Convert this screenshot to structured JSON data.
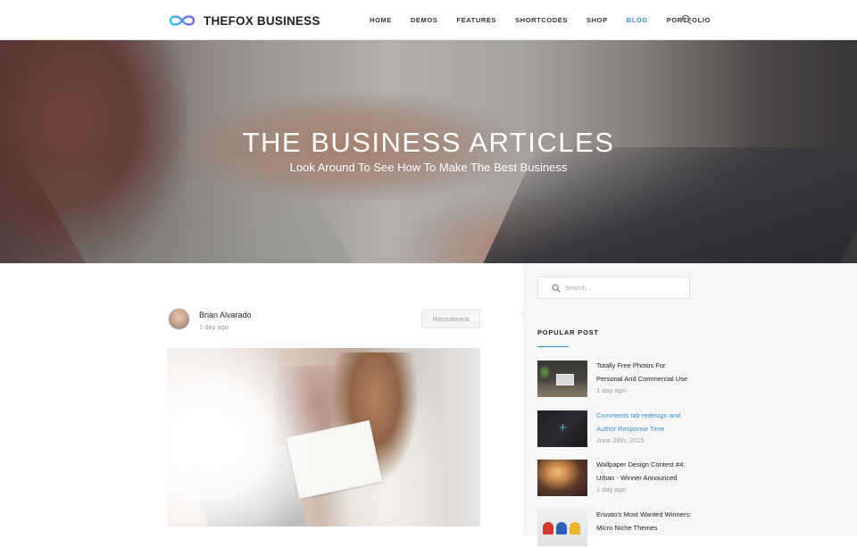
{
  "header": {
    "brand": "THEFOX BUSINESS",
    "nav": [
      "HOME",
      "DEMOS",
      "FEATURES",
      "SHORTCODES",
      "SHOP",
      "BLOG",
      "PORTFOLIO"
    ],
    "active_nav": "BLOG",
    "search_icon": "search-icon"
  },
  "hero": {
    "title": "THE BUSINESS ARTICLES",
    "subtitle": "Look Around To See How To Make The Best Business"
  },
  "post": {
    "author": "Brian Alvarado",
    "date": "1 day ago",
    "category": "Recruitment"
  },
  "sidebar": {
    "search_placeholder": "Search...",
    "popular_heading": "POPULAR POST",
    "popular_posts": [
      {
        "title": "Totally Free Photos For Personal And Commercial Use",
        "date": "1 day ago"
      },
      {
        "title": "Comments tab redesign and Author Response Time",
        "date": "June 28th, 2015"
      },
      {
        "title": "Wallpaper Design Contest #4: Urban - Winner Announced",
        "date": "1 day ago"
      },
      {
        "title": "Envato's Most Wanted Winners: Micro Niche Themes",
        "date": ""
      }
    ]
  },
  "colors": {
    "accent": "#3a8fd9",
    "sidebar_bg": "#f7f7f7"
  }
}
